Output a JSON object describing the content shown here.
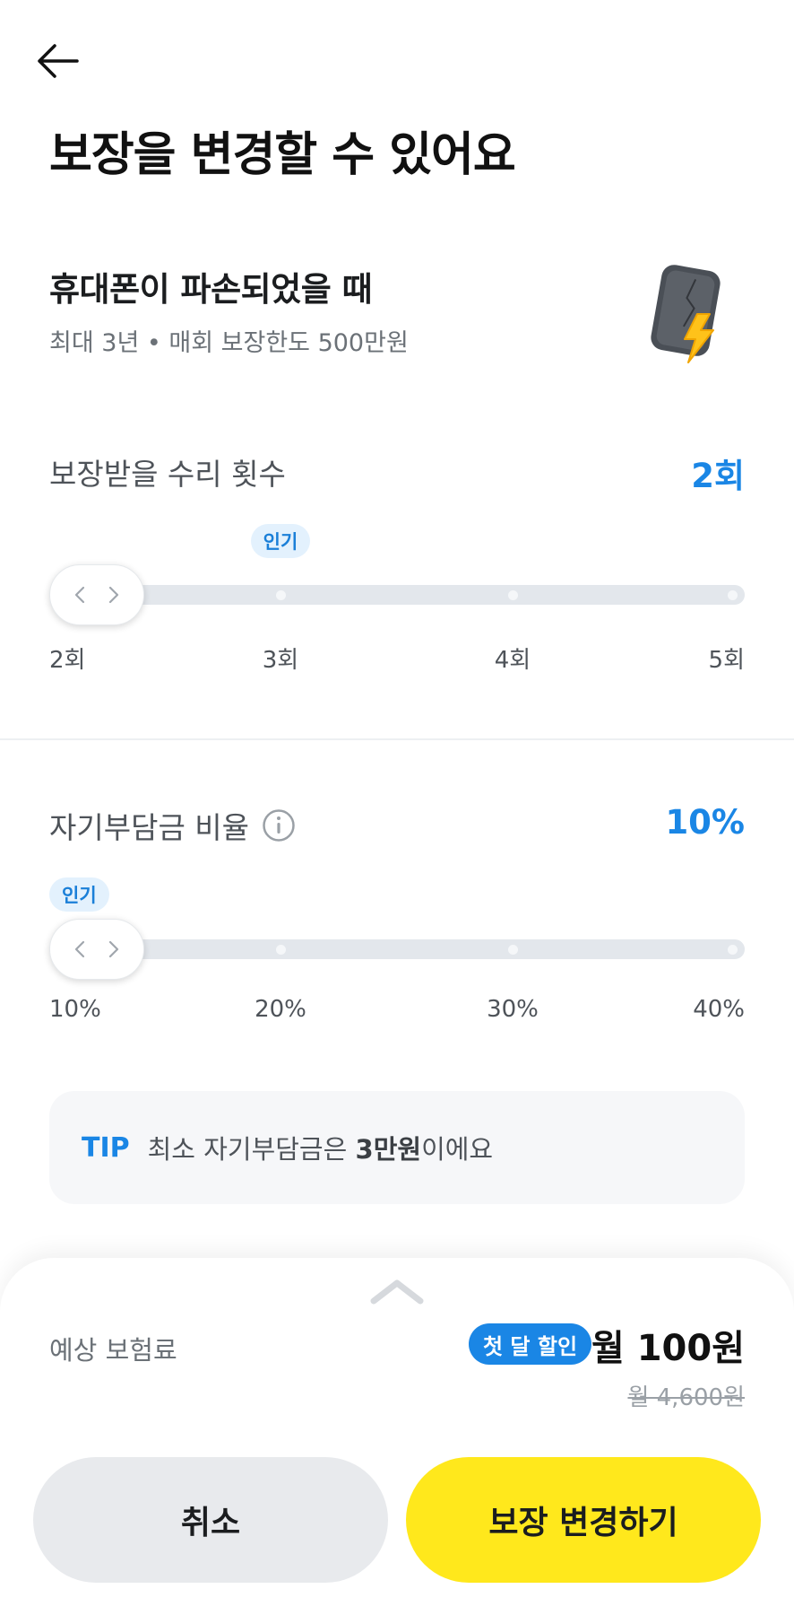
{
  "header": {
    "back_icon": "arrow-left-icon",
    "title": "보장을 변경할 수 있어요"
  },
  "coverage": {
    "title": "휴대폰이 파손되었을 때",
    "subtitle": "최대 3년 • 매회 보장한도 500만원",
    "illustration": "broken-phone-lightning-icon"
  },
  "repair_count": {
    "label": "보장받을 수리 횟수",
    "value": "2회",
    "badge": "인기",
    "selected_index": 0,
    "badge_index": 1,
    "ticks": [
      "2회",
      "3회",
      "4회",
      "5회"
    ]
  },
  "deductible": {
    "label": "자기부담금 비율",
    "info_icon": "info-circle-icon",
    "value": "10%",
    "badge": "인기",
    "selected_index": 0,
    "badge_index": 0,
    "ticks": [
      "10%",
      "20%",
      "30%",
      "40%"
    ]
  },
  "tip": {
    "tag": "TIP",
    "text_before": "최소 자기부담금은 ",
    "text_bold": "3만원",
    "text_after": "이에요"
  },
  "premium": {
    "handle_icon": "chevron-up-icon",
    "label": "예상 보험료",
    "discount_badge": "첫 달 할인",
    "price": "월 100원",
    "original_price": "월 4,600원"
  },
  "buttons": {
    "cancel": "취소",
    "confirm": "보장 변경하기"
  },
  "colors": {
    "accent_blue": "#1a86e5",
    "cta_yellow": "#ffe81c",
    "track_gray": "#e3e7ec"
  }
}
